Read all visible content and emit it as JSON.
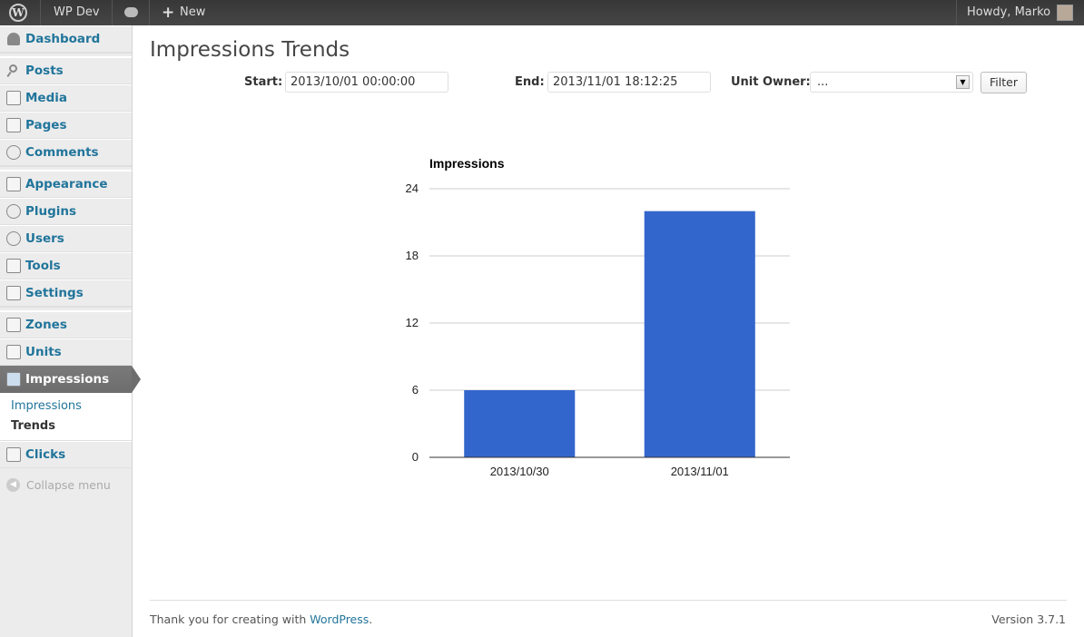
{
  "adminbar": {
    "site_name": "WP Dev",
    "new_label": "New",
    "greeting": "Howdy, Marko"
  },
  "sidebar": {
    "items": [
      {
        "label": "Dashboard",
        "icon": "dashboard-icon"
      },
      {
        "label": "Posts",
        "icon": "pin-icon"
      },
      {
        "label": "Media",
        "icon": "media-icon"
      },
      {
        "label": "Pages",
        "icon": "pages-icon"
      },
      {
        "label": "Comments",
        "icon": "comment-icon"
      },
      {
        "label": "Appearance",
        "icon": "appearance-icon"
      },
      {
        "label": "Plugins",
        "icon": "plug-icon"
      },
      {
        "label": "Users",
        "icon": "users-icon"
      },
      {
        "label": "Tools",
        "icon": "tools-icon"
      },
      {
        "label": "Settings",
        "icon": "settings-icon"
      },
      {
        "label": "Zones",
        "icon": "zones-icon"
      },
      {
        "label": "Units",
        "icon": "units-icon"
      },
      {
        "label": "Impressions",
        "icon": "impressions-icon"
      },
      {
        "label": "Clicks",
        "icon": "clicks-icon"
      }
    ],
    "submenu": [
      "Impressions",
      "Trends"
    ],
    "collapse_label": "Collapse menu"
  },
  "page": {
    "title": "Impressions Trends"
  },
  "filters": {
    "start_label": "Start:",
    "start_value": "2013/10/01 00:00:00",
    "end_label": "End:",
    "end_value": "2013/11/01 18:12:25",
    "owner_label": "Unit Owner:",
    "owner_value": "...",
    "filter_button": "Filter"
  },
  "chart_data": {
    "type": "bar",
    "title": "Impressions",
    "categories": [
      "2013/10/30",
      "2013/11/01"
    ],
    "values": [
      6,
      22
    ],
    "ylim": [
      0,
      24
    ],
    "yticks": [
      0,
      6,
      12,
      18,
      24
    ],
    "color": "#3366cc",
    "grid": true
  },
  "footer": {
    "thanks_prefix": "Thank you for creating with ",
    "thanks_link": "WordPress",
    "thanks_suffix": ".",
    "version": "Version 3.7.1"
  }
}
